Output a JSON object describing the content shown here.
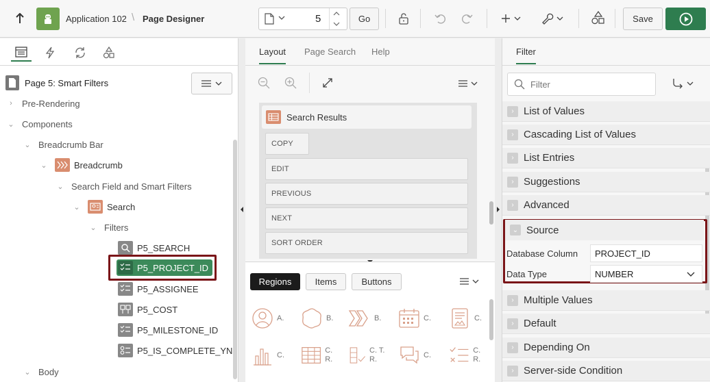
{
  "toolbar": {
    "app_name": "Application 102",
    "page_designer": "Page Designer",
    "page_number": "5",
    "go_label": "Go",
    "save_label": "Save"
  },
  "left_panel": {
    "page_title": "Page 5: Smart Filters",
    "tree": [
      {
        "label": "Pre-Rendering"
      },
      {
        "label": "Components"
      },
      {
        "label": "Breadcrumb Bar"
      },
      {
        "label": "Breadcrumb"
      },
      {
        "label": "Search Field and Smart Filters"
      },
      {
        "label": "Search"
      },
      {
        "label": "Filters"
      },
      {
        "label": "P5_SEARCH"
      },
      {
        "label": "P5_PROJECT_ID"
      },
      {
        "label": "P5_ASSIGNEE"
      },
      {
        "label": "P5_COST"
      },
      {
        "label": "P5_MILESTONE_ID"
      },
      {
        "label": "P5_IS_COMPLETE_YN"
      },
      {
        "label": "Body"
      }
    ]
  },
  "middle_panel": {
    "tabs": [
      "Layout",
      "Page Search",
      "Help"
    ],
    "region_title": "Search Results",
    "buttons": [
      "COPY",
      "EDIT",
      "PREVIOUS",
      "NEXT",
      "SORT ORDER"
    ],
    "palette_tabs": [
      "Regions",
      "Items",
      "Buttons"
    ],
    "palette_items": [
      {
        "label": "A.",
        "icon": "avatar-icon"
      },
      {
        "label": "B.",
        "icon": "badge-icon"
      },
      {
        "label": "B.",
        "icon": "breadcrumb-icon"
      },
      {
        "label": "C.",
        "icon": "calendar-icon"
      },
      {
        "label": "C.",
        "icon": "card-icon"
      },
      {
        "label": "C.",
        "icon": "chart-icon"
      },
      {
        "label": "C. R.",
        "icon": "classic-report-icon"
      },
      {
        "label": "C. T. R.",
        "icon": "column-toggle-icon"
      },
      {
        "label": "C.",
        "icon": "comments-icon"
      },
      {
        "label": "C. R.",
        "icon": "content-row-icon"
      }
    ]
  },
  "right_panel": {
    "tab": "Filter",
    "filter_placeholder": "Filter",
    "groups_before": [
      "List of Values",
      "Cascading List of Values",
      "List Entries",
      "Suggestions",
      "Advanced"
    ],
    "source_group": "Source",
    "source_rows": [
      {
        "label": "Database Column",
        "value": "PROJECT_ID"
      },
      {
        "label": "Data Type",
        "value": "NUMBER"
      }
    ],
    "groups_after": [
      "Multiple Values",
      "Default",
      "Depending On",
      "Server-side Condition"
    ]
  }
}
